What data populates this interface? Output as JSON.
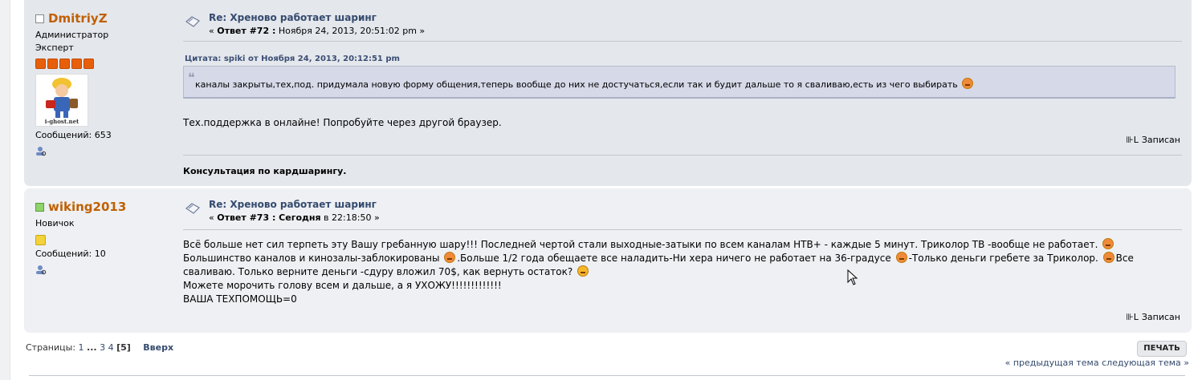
{
  "posts": [
    {
      "author": "DmitriyZ",
      "online": false,
      "group": "Администратор",
      "rank": "Эксперт",
      "stars": 5,
      "avatar_caption": "i-ghost.net",
      "posts_count": "Сообщений: 653",
      "title": "Re: Хреново работает шаринг",
      "meta_prefix": "« ",
      "reply_label": "Ответ #72 :",
      "date": " Ноября 24, 2013, 20:51:02 pm »",
      "quote_header": "Цитата: spiki от Ноября 24, 2013, 20:12:51 pm",
      "quote_text": "каналы закрыты,тех,под. придумала новую форму общения,теперь вообще до них  не достучаться,если так и будит дальше то я сваливаю,есть из чего выбирать",
      "body": "Тех.поддержка в онлайне! Попробуйте через другой браузер.",
      "reported": "Записан",
      "signature": "Консультация по кардшарингу."
    },
    {
      "author": "wiking2013",
      "online": true,
      "group": "Новичок",
      "stars": 1,
      "posts_count": "Сообщений: 10",
      "title": "Re: Хреново работает шаринг",
      "meta_prefix": "« ",
      "reply_label": "Ответ #73 :",
      "date_bold": " Сегодня",
      "date_rest": " в 22:18:50 »",
      "body_lines": [
        "Всё больше нет сил терпеть эту Вашу гребанную шару!!! Последней чертой стали выходные-затыки по всем каналам НТВ+ - каждые 5 минут. Триколор ТВ -вообще не работает.",
        "Большинство каналов и кинозалы-заблокированы ",
        ".Больше 1/2 года обещаете все наладить-Ни хера ничего не работает на 36-градусе ",
        "-Только деньги гребете за Триколор. ",
        "Все",
        "сваливаю. Только верните деньги -сдуру  вложил 70$, как вернуть остаток? ",
        "Можете морочить голову всем и дальше, а я УХОЖУ!!!!!!!!!!!!!",
        "ВАША ТЕХПОМОЩЬ=0"
      ],
      "reported": "Записан"
    }
  ],
  "pagination": {
    "label": "Страницы:",
    "p1": "1",
    "ellipsis": "...",
    "p3": "3",
    "p4": "4",
    "current": "[5]",
    "top": "Вверх"
  },
  "print_label": "ПЕЧАТЬ",
  "nav": {
    "prev": "« предыдущая тема",
    "next": "следующая тема »"
  },
  "colors": {
    "username": "#c06002",
    "link": "#344a6e",
    "post_bg": "#e4e7ec",
    "quote_bg": "#d6d9e8"
  }
}
